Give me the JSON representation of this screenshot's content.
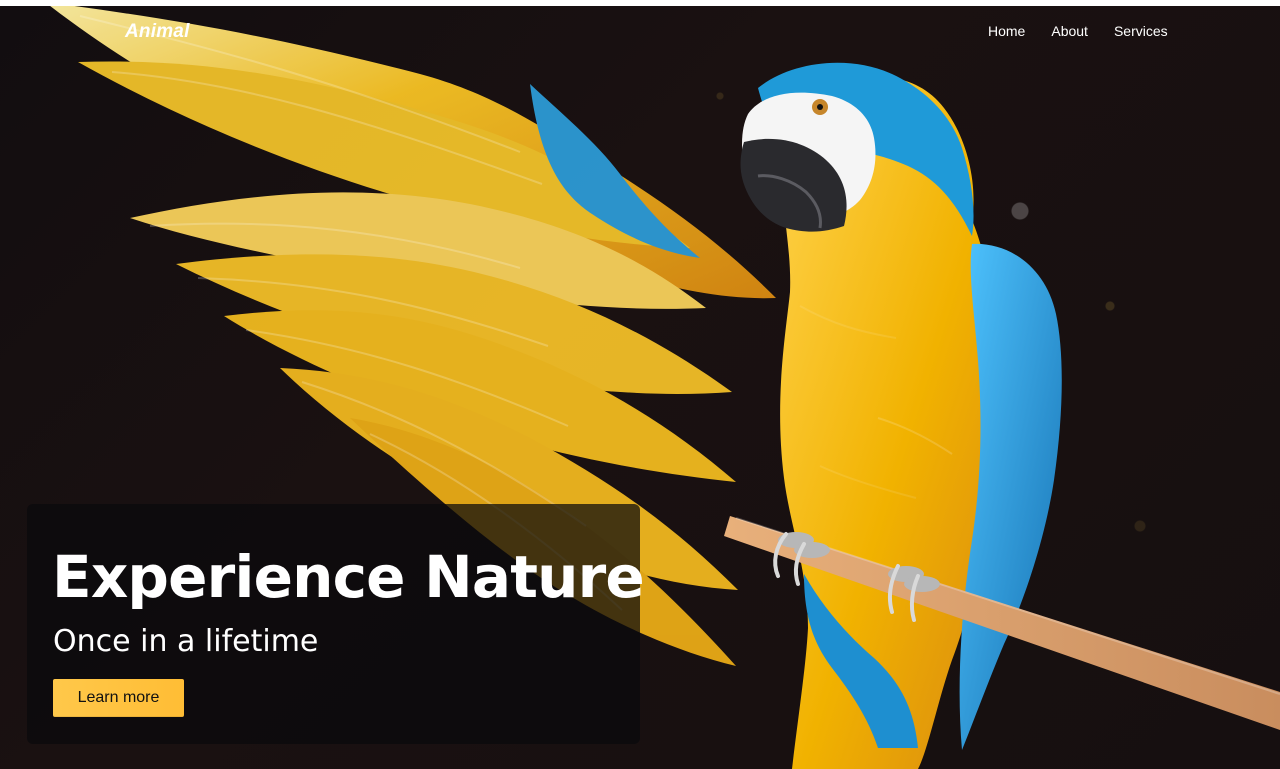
{
  "navbar": {
    "logo": "Animal",
    "links": [
      {
        "label": "Home"
      },
      {
        "label": "About"
      },
      {
        "label": "Services"
      }
    ]
  },
  "hero": {
    "image_icon": "parrot-image",
    "headline": "Experience Nature",
    "subheadline": "Once in a lifetime",
    "button_label": "Learn more"
  },
  "colors": {
    "background": "#150f10",
    "panel": "#0b0b0d",
    "button": "#ffc84a",
    "macaw_yellow": "#f4b400",
    "macaw_orange": "#df7d1b",
    "macaw_blue": "#1c98d1"
  }
}
